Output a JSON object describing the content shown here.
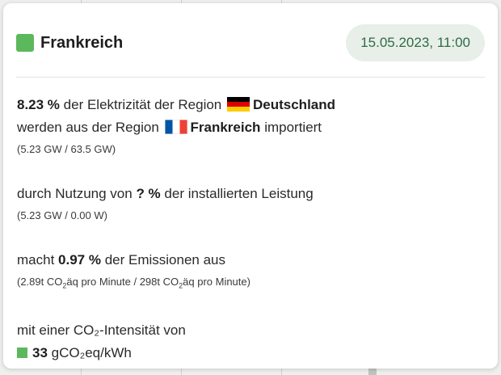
{
  "colors": {
    "region_swatch": "#5cb85c",
    "intensity_swatch": "#5cb85c",
    "date_text": "#2f6b44",
    "date_bg": "#e8efe9"
  },
  "header": {
    "title": "Frankreich",
    "datetime": "15.05.2023, 11:00"
  },
  "import": {
    "percent": "8.23 %",
    "text1": "der Elektrizität der Region",
    "target_region": "Deutschland",
    "text2": "werden aus der Region",
    "source_region": "Frankreich",
    "text3": "importiert",
    "detail": "(5.23 GW / 63.5 GW)"
  },
  "utilization": {
    "text1": "durch Nutzung von",
    "percent": "? %",
    "text2": "der installierten Leistung",
    "detail": "(5.23 GW / 0.00 W)"
  },
  "emissions": {
    "text1": "macht",
    "percent": "0.97 %",
    "text2": "der Emissionen aus",
    "detail_a_prefix": "(2.89t CO",
    "detail_a_sub": "2",
    "detail_a_suffix": "äq pro Minute / 298t CO",
    "detail_b_sub": "2",
    "detail_b_suffix": "äq pro Minute)"
  },
  "intensity": {
    "label_prefix": "mit einer CO",
    "label_sub": "₂",
    "label_suffix": "-Intensität von",
    "value": "33",
    "unit": "gCO₂eq/kWh"
  }
}
